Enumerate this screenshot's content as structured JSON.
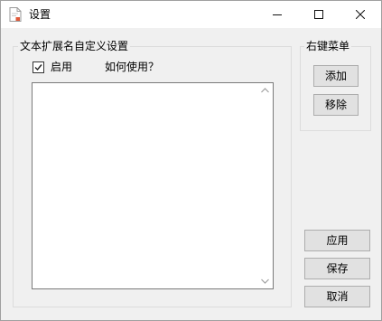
{
  "window": {
    "title": "设置",
    "controls": {
      "minimize": "minimize-icon",
      "maximize": "maximize-icon",
      "close": "close-icon"
    }
  },
  "extension_group": {
    "title": "文本扩展名自定义设置",
    "enable_label": "启用",
    "enable_checked": true,
    "help_link": "如何使用？",
    "textarea_value": ""
  },
  "context_menu_group": {
    "title": "右键菜单",
    "add_label": "添加",
    "remove_label": "移除"
  },
  "actions": {
    "apply_label": "应用",
    "save_label": "保存",
    "cancel_label": "取消"
  },
  "colors": {
    "window_bg": "#f0f0f0",
    "titlebar_bg": "#ffffff",
    "button_bg": "#e1e1e1",
    "button_border": "#adadad",
    "icon_accent": "#e05a3a"
  }
}
